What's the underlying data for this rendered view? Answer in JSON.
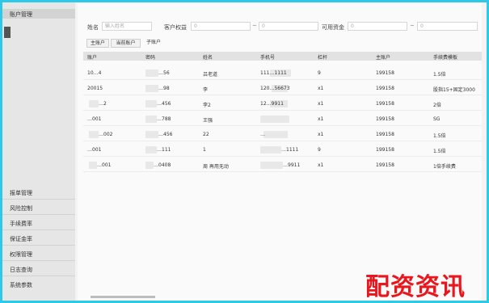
{
  "sidebar": {
    "title": "账户管理",
    "bottom_items": [
      "报单管理",
      "风险控制",
      "手续费率",
      "保证金率",
      "权限管理",
      "日志查询",
      "系统参数"
    ]
  },
  "filters": {
    "name_label": "姓名",
    "name_placeholder": "输入姓名",
    "equity_label": "客户权益",
    "equity_from": "0",
    "equity_to": "0",
    "available_label": "可用资金",
    "available_from": "0",
    "available_to": "0",
    "separator": "~"
  },
  "tabs": [
    "主账户",
    "当前账户",
    "子账户"
  ],
  "table": {
    "headers": [
      "账户",
      "密码",
      "姓名",
      "手机号",
      "杠杆",
      "主账户",
      "手续费模板"
    ],
    "rows": [
      [
        "10…4",
        "…56",
        "吕老道",
        "111…1111",
        "9",
        "199158",
        "1.5倍"
      ],
      [
        "20015",
        "…98",
        "李",
        "120…56673",
        "x1",
        "199158",
        "股指15+固定3000"
      ],
      [
        "…2",
        "…456",
        "李2",
        "12…9911",
        "x1",
        "199158",
        "2倍"
      ],
      [
        "…001",
        "…788",
        "王强",
        "",
        "x1",
        "199158",
        "SG"
      ],
      [
        "…002",
        "…456",
        "22",
        "…",
        "x1",
        "199158",
        "1.5倍"
      ],
      [
        "…001",
        "…111",
        "1",
        "…1111",
        "9",
        "199158",
        "1.5倍"
      ],
      [
        "…001",
        "…0408",
        "周   再用无动",
        "…9911",
        "x1",
        "199158",
        "1倍手续费"
      ]
    ]
  },
  "watermark": "配资资讯"
}
